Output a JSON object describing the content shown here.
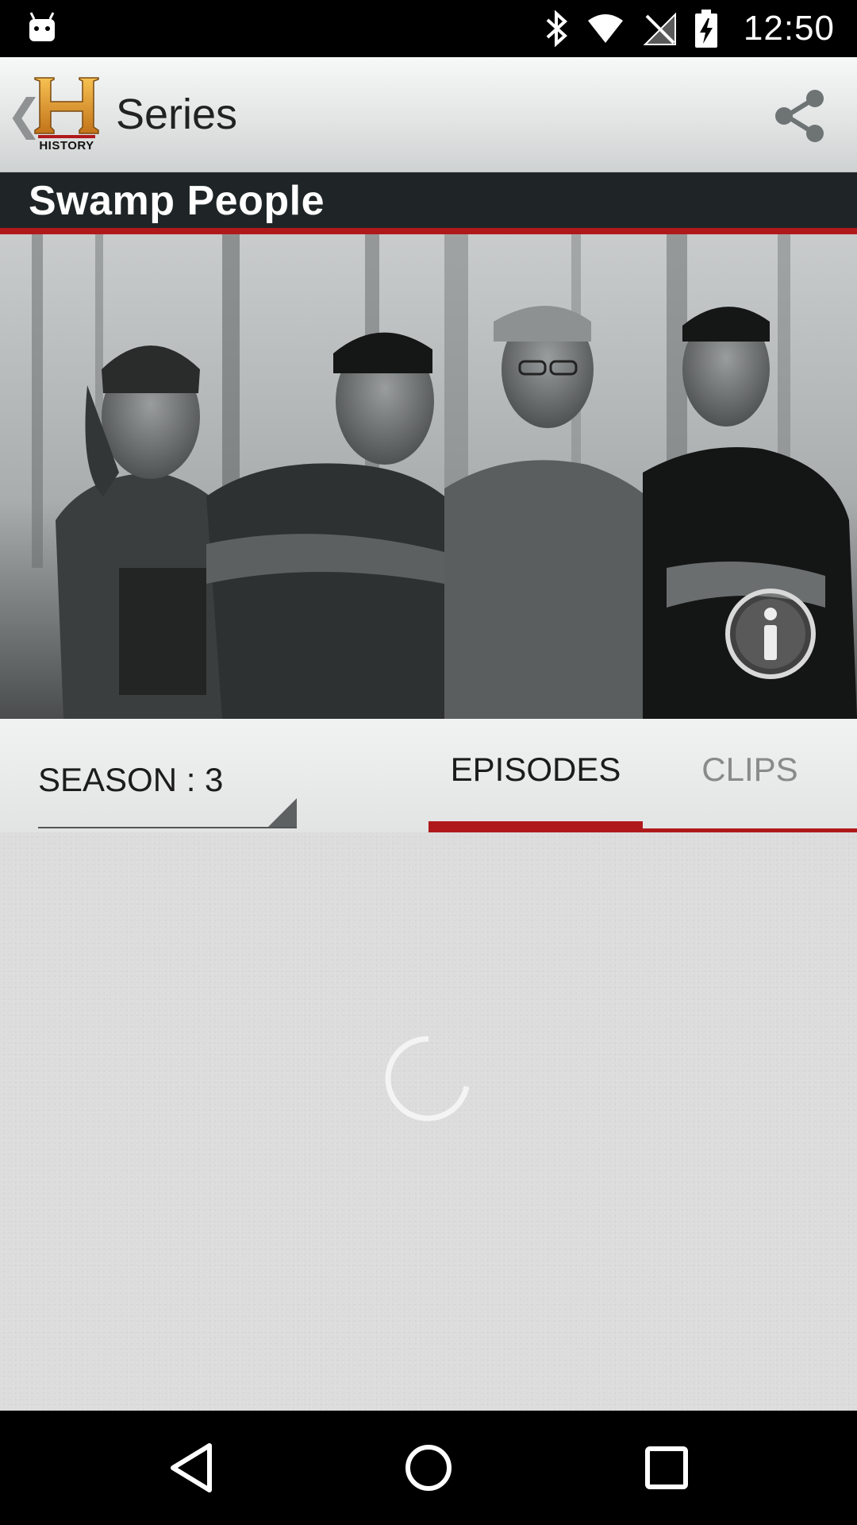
{
  "status_bar": {
    "time": "12:50",
    "icons": [
      "android-debug-icon",
      "bluetooth-icon",
      "wifi-icon",
      "no-signal-icon",
      "battery-charging-icon"
    ]
  },
  "action_bar": {
    "back_icon": "chevron-left-icon",
    "logo_text": "HISTORY",
    "title": "Series",
    "share_icon": "share-icon"
  },
  "show": {
    "title": "Swamp People",
    "info_icon": "info-icon"
  },
  "season_selector": {
    "label": "SEASON : 3"
  },
  "tabs": [
    {
      "label": "EPISODES",
      "selected": true
    },
    {
      "label": "CLIPS",
      "selected": false
    }
  ],
  "content": {
    "state": "loading"
  },
  "colors": {
    "accent_red": "#b0191b",
    "title_band": "#1f2527",
    "action_bar": "#e1e3e3",
    "content_bg": "#dcdcdc"
  },
  "nav_bar": {
    "buttons": [
      "back-triangle-icon",
      "home-circle-icon",
      "recents-square-icon"
    ]
  }
}
